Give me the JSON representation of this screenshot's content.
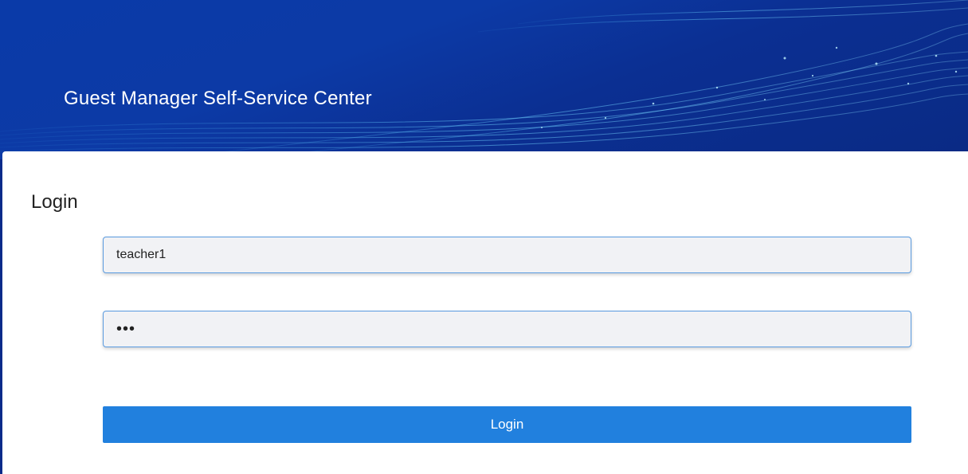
{
  "header": {
    "title": "Guest Manager Self-Service Center"
  },
  "login": {
    "heading": "Login",
    "username_value": "teacher1",
    "password_value": "•••",
    "submit_label": "Login"
  },
  "colors": {
    "banner": "#0a3aa8",
    "panel": "#ffffff",
    "button": "#2180de",
    "field_border": "#5a9be0"
  }
}
